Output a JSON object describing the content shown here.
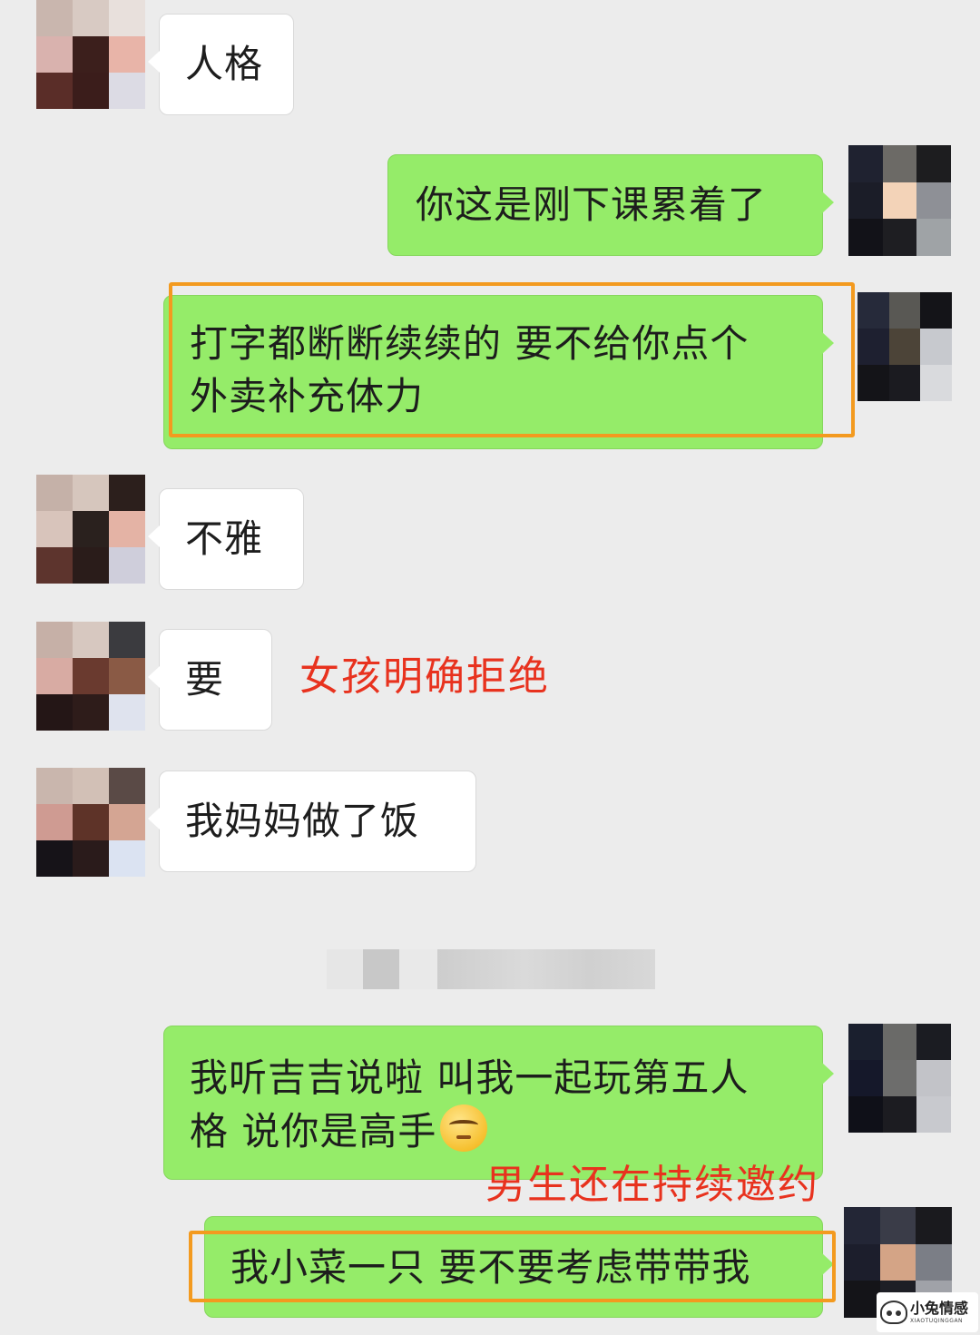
{
  "messages": [
    {
      "text_lines": [
        "人格"
      ]
    },
    {
      "text_lines": [
        "你这是刚下课累着了"
      ]
    },
    {
      "text_lines": [
        "打字都断断续续的 要不给你点个",
        "外卖补充体力"
      ]
    },
    {
      "text_lines": [
        "不雅"
      ]
    },
    {
      "text_lines": [
        "要"
      ]
    },
    {
      "text_lines": [
        "我妈妈做了饭"
      ]
    },
    {
      "text_lines": [
        "我听吉吉说啦 叫我一起玩第五人",
        "格 说你是高手"
      ],
      "emoji": "smirk-emoji"
    },
    {
      "text_lines": [
        "我小菜一只 要不要考虑带带我"
      ]
    }
  ],
  "annotations": {
    "girl_refuses": "女孩明确拒绝",
    "boy_keeps_inviting": "男生还在持续邀约"
  },
  "watermark": {
    "main": "小兔情感",
    "sub": "XIAOTUQINGGAN"
  },
  "colors": {
    "background": "#ececec",
    "incoming_bubble": "#ffffff",
    "outgoing_bubble": "#95ec69",
    "highlight_box": "#f39a1f",
    "annotation_text": "#e8321e"
  },
  "icons": {
    "avatar_incoming": "pixelated-avatar",
    "avatar_outgoing": "pixelated-avatar",
    "timestamp": "blurred-timestamp"
  }
}
